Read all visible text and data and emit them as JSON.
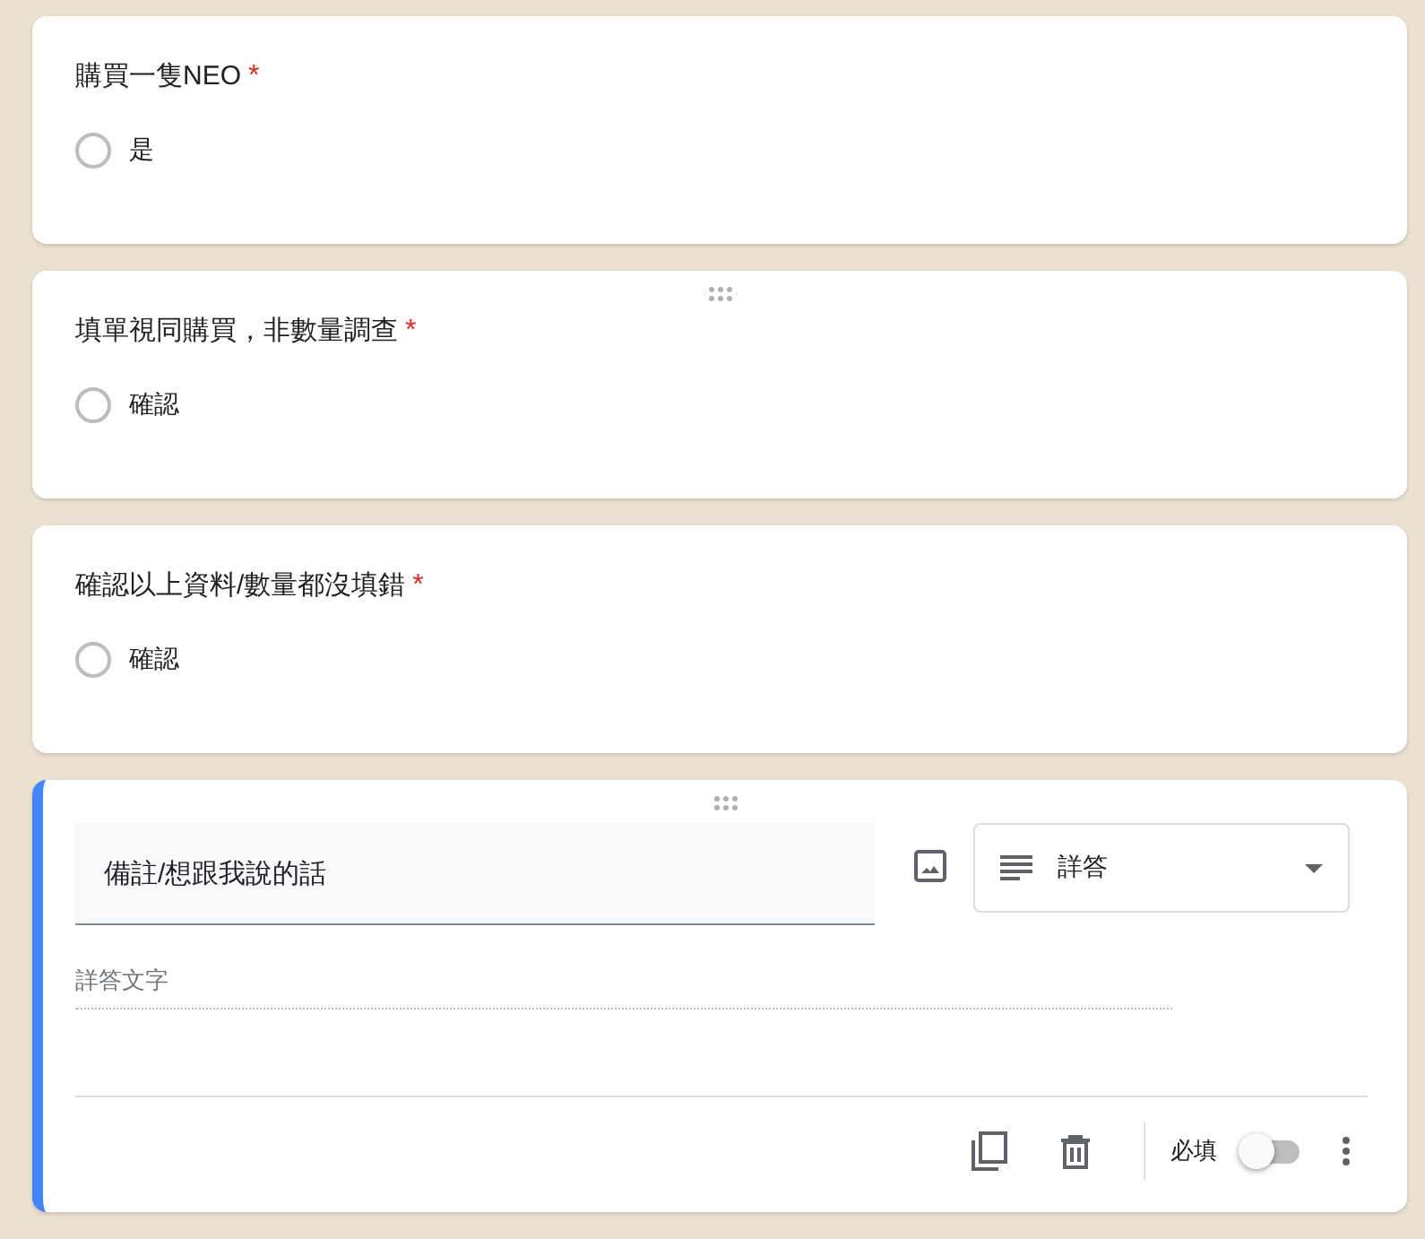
{
  "questions": [
    {
      "title": "購買一隻NEO",
      "required_mark": "*",
      "drag_handle": false,
      "options": [
        {
          "label": "是",
          "selected": false
        }
      ]
    },
    {
      "title": "填單視同購買，非數量調查",
      "required_mark": "*",
      "drag_handle": true,
      "options": [
        {
          "label": "確認",
          "selected": false
        }
      ]
    },
    {
      "title": "確認以上資料/數量都沒填錯",
      "required_mark": "*",
      "drag_handle": false,
      "options": [
        {
          "label": "確認",
          "selected": false
        }
      ]
    }
  ],
  "editor": {
    "active": true,
    "drag_handle": true,
    "title": "備註/想跟我說的話",
    "type_label": "詳答",
    "answer_placeholder": "詳答文字",
    "required_label": "必填",
    "required_on": false
  }
}
